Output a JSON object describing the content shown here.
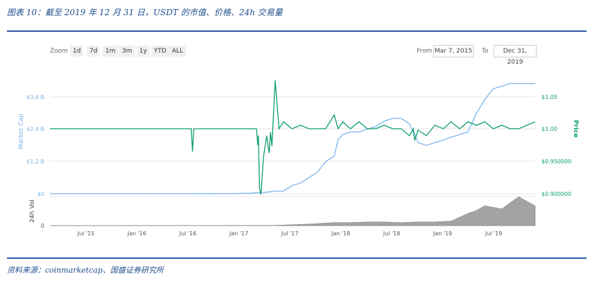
{
  "caption": "图表 10：截至 2019 年 12 月 31 日，USDT 的市值、价格、24h 交易量",
  "source": "资料来源：coinmarketcap、国盛证券研究所",
  "toolbar": {
    "zoom_label": "Zoom",
    "zoom_buttons": [
      "1d",
      "7d",
      "1m",
      "3m",
      "1y",
      "YTD",
      "ALL"
    ],
    "from_label": "From",
    "from_value": "Mar 7, 2015",
    "to_label": "To",
    "to_value": "Dec 31, 2019"
  },
  "colors": {
    "market_cap": "#7cb5ec",
    "price": "#0a9d6e",
    "volume": "#8c8c8c",
    "caption": "#1f4e8c",
    "rule": "#2b5aa3"
  },
  "chart_data": {
    "type": "line",
    "x_tick_labels": [
      "Jul '15",
      "Jan '16",
      "Jul '16",
      "Jan '17",
      "Jul '17",
      "Jan '18",
      "Jul '18",
      "Jan '19",
      "Jul '19"
    ],
    "left_axis": {
      "label": "Market Cap",
      "ticks": [
        "$0",
        "$1.2 B",
        "$2.4 B",
        "$3.6 B"
      ],
      "ylim": [
        0,
        4.0
      ]
    },
    "right_axis": {
      "label": "Price",
      "ticks": [
        "$0.900000",
        "$0.950000",
        "$1.00",
        "$1.05"
      ],
      "ylim": [
        0.9,
        1.07
      ]
    },
    "volume_axis": {
      "label": "24h Vol",
      "ticks": [
        "0"
      ]
    },
    "series": [
      {
        "axis": "left",
        "x": [
          "2015-03-07",
          "2016-01-01",
          "2016-10-01",
          "2017-01-01",
          "2017-03-01",
          "2017-05-01",
          "2017-06-01",
          "2017-07-01",
          "2017-08-01",
          "2017-09-01",
          "2017-10-01",
          "2017-11-01",
          "2017-12-01",
          "2018-01-01",
          "2018-01-15",
          "2018-02-01",
          "2018-03-01",
          "2018-04-01",
          "2018-05-01",
          "2018-06-01",
          "2018-07-01",
          "2018-08-01",
          "2018-09-01",
          "2018-10-01",
          "2018-10-20",
          "2018-11-01",
          "2018-12-01",
          "2019-01-01",
          "2019-02-01",
          "2019-03-01",
          "2019-04-01",
          "2019-05-01",
          "2019-06-01",
          "2019-07-01",
          "2019-08-01",
          "2019-09-01",
          "2019-10-01",
          "2019-11-01",
          "2019-12-31"
        ],
        "values": [
          0.0005,
          0.001,
          0.005,
          0.01,
          0.02,
          0.06,
          0.1,
          0.1,
          0.3,
          0.4,
          0.6,
          0.8,
          1.2,
          1.4,
          2.0,
          2.2,
          2.3,
          2.3,
          2.4,
          2.5,
          2.7,
          2.8,
          2.8,
          2.6,
          2.2,
          1.9,
          1.8,
          1.9,
          2.0,
          2.1,
          2.2,
          2.3,
          3.0,
          3.5,
          3.9,
          4.0,
          4.1,
          4.1,
          4.1
        ]
      },
      {
        "axis": "right",
        "x": [
          "2015-03-07",
          "2016-07-01",
          "2016-08-01",
          "2016-08-05",
          "2016-08-10",
          "2017-01-01",
          "2017-03-25",
          "2017-03-30",
          "2017-04-01",
          "2017-04-05",
          "2017-04-10",
          "2017-04-20",
          "2017-05-01",
          "2017-05-10",
          "2017-05-15",
          "2017-05-20",
          "2017-06-01",
          "2017-06-15",
          "2017-07-01",
          "2017-08-01",
          "2017-09-01",
          "2017-10-01",
          "2017-11-01",
          "2017-12-01",
          "2018-01-01",
          "2018-01-15",
          "2018-02-01",
          "2018-03-01",
          "2018-04-01",
          "2018-05-01",
          "2018-06-01",
          "2018-07-01",
          "2018-08-01",
          "2018-09-01",
          "2018-10-01",
          "2018-10-15",
          "2018-10-20",
          "2018-11-01",
          "2018-12-01",
          "2019-01-01",
          "2019-02-01",
          "2019-03-01",
          "2019-04-01",
          "2019-05-01",
          "2019-06-01",
          "2019-07-01",
          "2019-08-01",
          "2019-09-01",
          "2019-10-01",
          "2019-11-01",
          "2019-12-31"
        ],
        "values": [
          1.0,
          1.0,
          1.0,
          0.967,
          1.0,
          1.0,
          1.0,
          0.976,
          0.99,
          0.915,
          0.905,
          0.96,
          0.99,
          0.965,
          0.995,
          0.975,
          1.07,
          1.0,
          1.01,
          1.0,
          1.005,
          1.0,
          1.0,
          1.0,
          1.02,
          1.0,
          1.01,
          1.0,
          1.01,
          1.0,
          1.0,
          1.005,
          1.0,
          1.0,
          0.99,
          1.0,
          0.983,
          0.998,
          0.99,
          1.005,
          1.0,
          1.01,
          1.0,
          1.01,
          1.005,
          1.01,
          1.0,
          1.005,
          1.0,
          1.0,
          1.01
        ]
      },
      {
        "axis": "volume",
        "x": [
          "2015-03-07",
          "2017-06-01",
          "2017-10-01",
          "2018-01-01",
          "2018-03-01",
          "2018-05-01",
          "2018-07-01",
          "2018-09-01",
          "2018-11-01",
          "2019-01-01",
          "2019-03-01",
          "2019-05-01",
          "2019-06-01",
          "2019-07-01",
          "2019-08-01",
          "2019-09-01",
          "2019-10-01",
          "2019-11-01",
          "2019-12-31"
        ],
        "values": [
          0,
          0.01,
          0.05,
          0.1,
          0.1,
          0.12,
          0.12,
          0.1,
          0.12,
          0.12,
          0.15,
          0.4,
          0.5,
          0.65,
          0.6,
          0.55,
          0.75,
          0.95,
          0.65
        ]
      }
    ]
  }
}
